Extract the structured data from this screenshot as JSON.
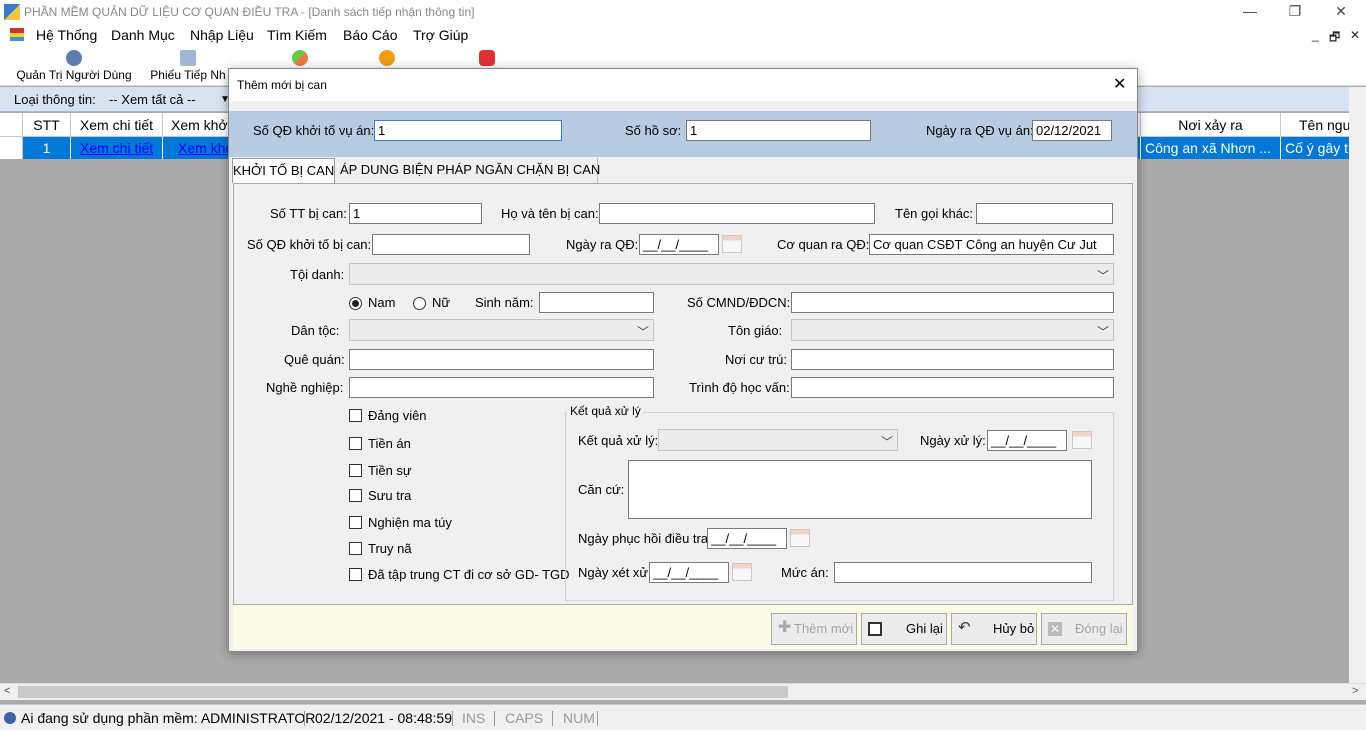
{
  "window": {
    "title": "PHẦN MỀM QUẢN DỮ LIỆU CƠ QUAN ĐIỀU TRA - [Danh sách tiếp nhận thông tin]",
    "minimize": "—",
    "restore": "❐",
    "close": "✕"
  },
  "menu": {
    "items": [
      "Hệ Thống",
      "Danh Mục",
      "Nhập Liệu",
      "Tìm Kiếm",
      "Báo Cáo",
      "Trợ Giúp"
    ],
    "mdi_controls": [
      "_",
      "🗗",
      "✕"
    ]
  },
  "toolbar": {
    "users": "Quản Trị Người Dùng",
    "receipt": "Phiếu Tiếp Nh"
  },
  "filter": {
    "label": "Loại thông tin:",
    "value": "-- Xem tất cả --"
  },
  "grid": {
    "headers": [
      "STT",
      "Xem chi tiết",
      "Xem khở",
      "Nơi xảy ra",
      "Tên nguồ"
    ],
    "row": {
      "stt": "1",
      "detail_link": "Xem chi tiết",
      "prosecute_link": "Xem khở",
      "place": "Công an xã Nhơn ...",
      "source": "Cố ý gây thư"
    }
  },
  "statusbar": {
    "user": "Ai đang sử dụng phần mềm: ADMINISTRATOR",
    "datetime": "02/12/2021 - 08:48:59",
    "ins": "INS",
    "caps": "CAPS",
    "num": "NUM"
  },
  "dialog": {
    "title": "Thêm mới bị can",
    "close": "✕",
    "header": {
      "case_decision_label": "Số QĐ khởi tố vụ án:",
      "case_decision_value": "1",
      "file_no_label": "Số hồ sơ:",
      "file_no_value": "1",
      "decision_date_label": "Ngày ra QĐ vụ án:",
      "decision_date_value": "02/12/2021"
    },
    "tabs": [
      "KHỞI TỐ BỊ CAN",
      "ÁP DUNG BIỆN PHÁP NGĂN CHẶN BỊ CAN"
    ],
    "form": {
      "stt_label": "Số TT bị can:",
      "stt_value": "1",
      "fullname_label": "Họ và tên bị can:",
      "fullname_value": "",
      "alias_label": "Tên gọi khác:",
      "alias_value": "",
      "decision_no_label": "Số QĐ khởi tố bị can:",
      "decision_no_value": "",
      "decision_date_label": "Ngày ra QĐ:",
      "decision_date_value": "__/__/____",
      "agency_label": "Cơ quan ra QĐ:",
      "agency_value": "Cơ quan CSĐT Công an huyện Cư Jut",
      "charge_label": "Tội danh:",
      "charge_value": "",
      "gender_male": "Nam",
      "gender_female": "Nữ",
      "gender_selected": "Nam",
      "birth_year_label": "Sinh năm:",
      "birth_year_value": "",
      "id_label": "Số CMND/ĐDCN:",
      "id_value": "",
      "ethnicity_label": "Dân tộc:",
      "religion_label": "Tôn giáo:",
      "hometown_label": "Quê quán:",
      "hometown_value": "",
      "residence_label": "Nơi cư trú:",
      "residence_value": "",
      "job_label": "Nghề nghiệp:",
      "job_value": "",
      "education_label": "Trình độ học vấn:",
      "education_value": "",
      "checkboxes": [
        "Đảng viên",
        "Tiền án",
        "Tiền sự",
        "Sưu tra",
        "Nghiện ma túy",
        "Truy nã",
        "Đã tập trung CT đi cơ sở GD- TGD"
      ],
      "result_group": {
        "title": "Kết quả xử lý",
        "result_label": "Kết quả xử lý:",
        "date_label": "Ngày xử lý:",
        "date_value": "__/__/____",
        "basis_label": "Căn cứ:",
        "basis_value": "",
        "restore_label": "Ngày phục hồi điều tra:",
        "restore_value": "__/__/____",
        "trial_label": "Ngày xét xử:",
        "trial_value": "__/__/____",
        "sentence_label": "Mức án:",
        "sentence_value": ""
      }
    },
    "buttons": {
      "add": "Thêm mới",
      "save": "Ghi lại",
      "cancel": "Hủy bỏ",
      "close": "Đóng lại"
    }
  },
  "colors": {
    "selection": "#0078d7",
    "header_band": "#b7cbe2",
    "button_bar": "#fbfbe6"
  }
}
